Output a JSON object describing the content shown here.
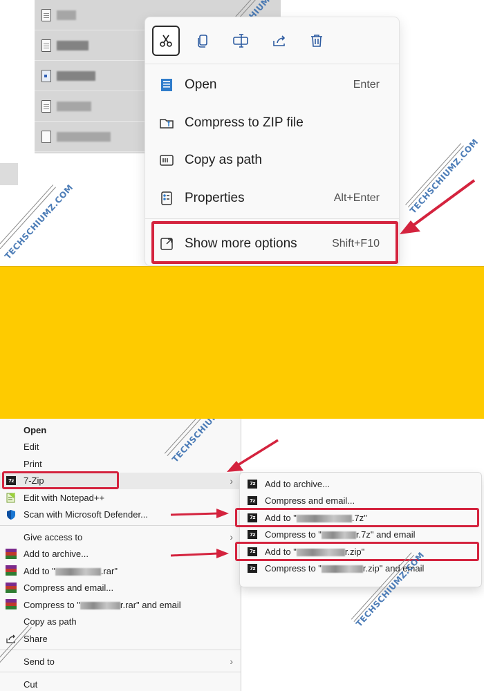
{
  "watermark": "TECHSCHIUMZ.COM",
  "modern_menu": {
    "toolbar": [
      "cut-icon",
      "copy-icon",
      "rename-icon",
      "share-icon",
      "delete-icon"
    ],
    "items": [
      {
        "label": "Open",
        "shortcut": "Enter",
        "icon": "open-app-icon"
      },
      {
        "label": "Compress to ZIP file",
        "shortcut": "",
        "icon": "zip-folder-icon"
      },
      {
        "label": "Copy as path",
        "shortcut": "",
        "icon": "copy-path-icon"
      },
      {
        "label": "Properties",
        "shortcut": "Alt+Enter",
        "icon": "properties-icon"
      },
      {
        "label": "Show more options",
        "shortcut": "Shift+F10",
        "icon": "show-more-options-icon"
      }
    ],
    "highlight_color": "#d4233e"
  },
  "classic_menu": {
    "items": [
      {
        "label": "Open",
        "bold": true
      },
      {
        "label": "Edit"
      },
      {
        "label": "Print"
      },
      {
        "label": "7-Zip"
      },
      {
        "label": "Edit with Notepad++"
      },
      {
        "label": "Scan with Microsoft Defender..."
      },
      {
        "label": "Give access to"
      },
      {
        "label": "Add to archive..."
      },
      {
        "label": "Add to \"",
        "suffix": ".rar\""
      },
      {
        "label": "Compress and email..."
      },
      {
        "label": "Compress to \"",
        "suffix": "r.rar\" and email"
      },
      {
        "label": "Copy as path"
      },
      {
        "label": "Share"
      },
      {
        "label": "Send to"
      },
      {
        "label": "Cut"
      }
    ]
  },
  "sevenzip_submenu": {
    "items": [
      {
        "label": "Add to archive..."
      },
      {
        "label": "Compress and email..."
      },
      {
        "label": "Add to \"",
        "suffix": ".7z\""
      },
      {
        "label": "Compress to \"",
        "suffix": "r.7z\" and email"
      },
      {
        "label": "Add to \"",
        "suffix": "r.zip\""
      },
      {
        "label": "Compress to \"",
        "suffix": "r.zip\" and email"
      }
    ]
  },
  "colors": {
    "band": "#fecb00",
    "accent_red": "#d4233e"
  }
}
